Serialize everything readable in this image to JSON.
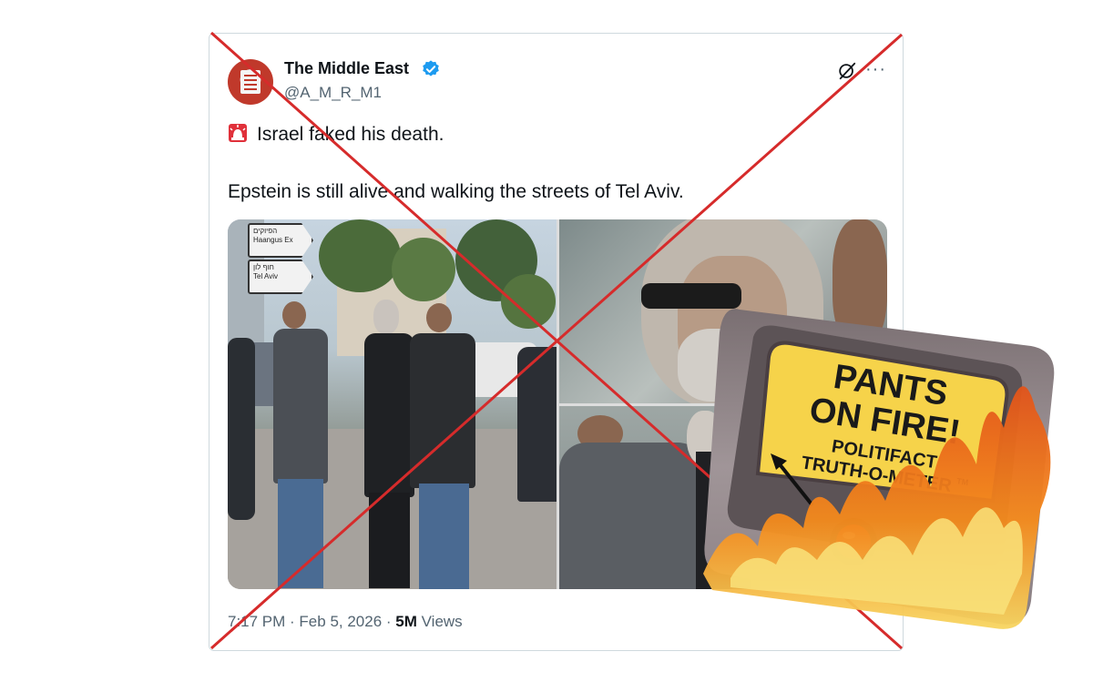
{
  "tweet": {
    "author_name": "The Middle East",
    "handle": "@A_M_R_M1",
    "line1": "Israel faked his death.",
    "line2": "Epstein is still alive and walking the streets of Tel Aviv.",
    "time": "7:17 PM",
    "date": "Feb 5, 2026",
    "views_count": "5M",
    "views_label": "Views",
    "icons": [
      "verified-badge-icon",
      "grok-icon",
      "more-icon",
      "siren-icon"
    ]
  },
  "photo": {
    "sign1_hebrew": "הפיוקים",
    "sign1_sub": "Haangus Ex",
    "sign2_hebrew": "חוף לון",
    "sign2_sub": "Tel Aviv"
  },
  "rating": {
    "line1": "PANTS",
    "line2": "ON FIRE!",
    "brand": "POLITIFACT",
    "meter": "TRUTH-O-METER",
    "tm": "TM"
  },
  "colors": {
    "verified": "#1d9bf0",
    "cross": "#d62b2b",
    "meter_face": "#f6d34a"
  }
}
